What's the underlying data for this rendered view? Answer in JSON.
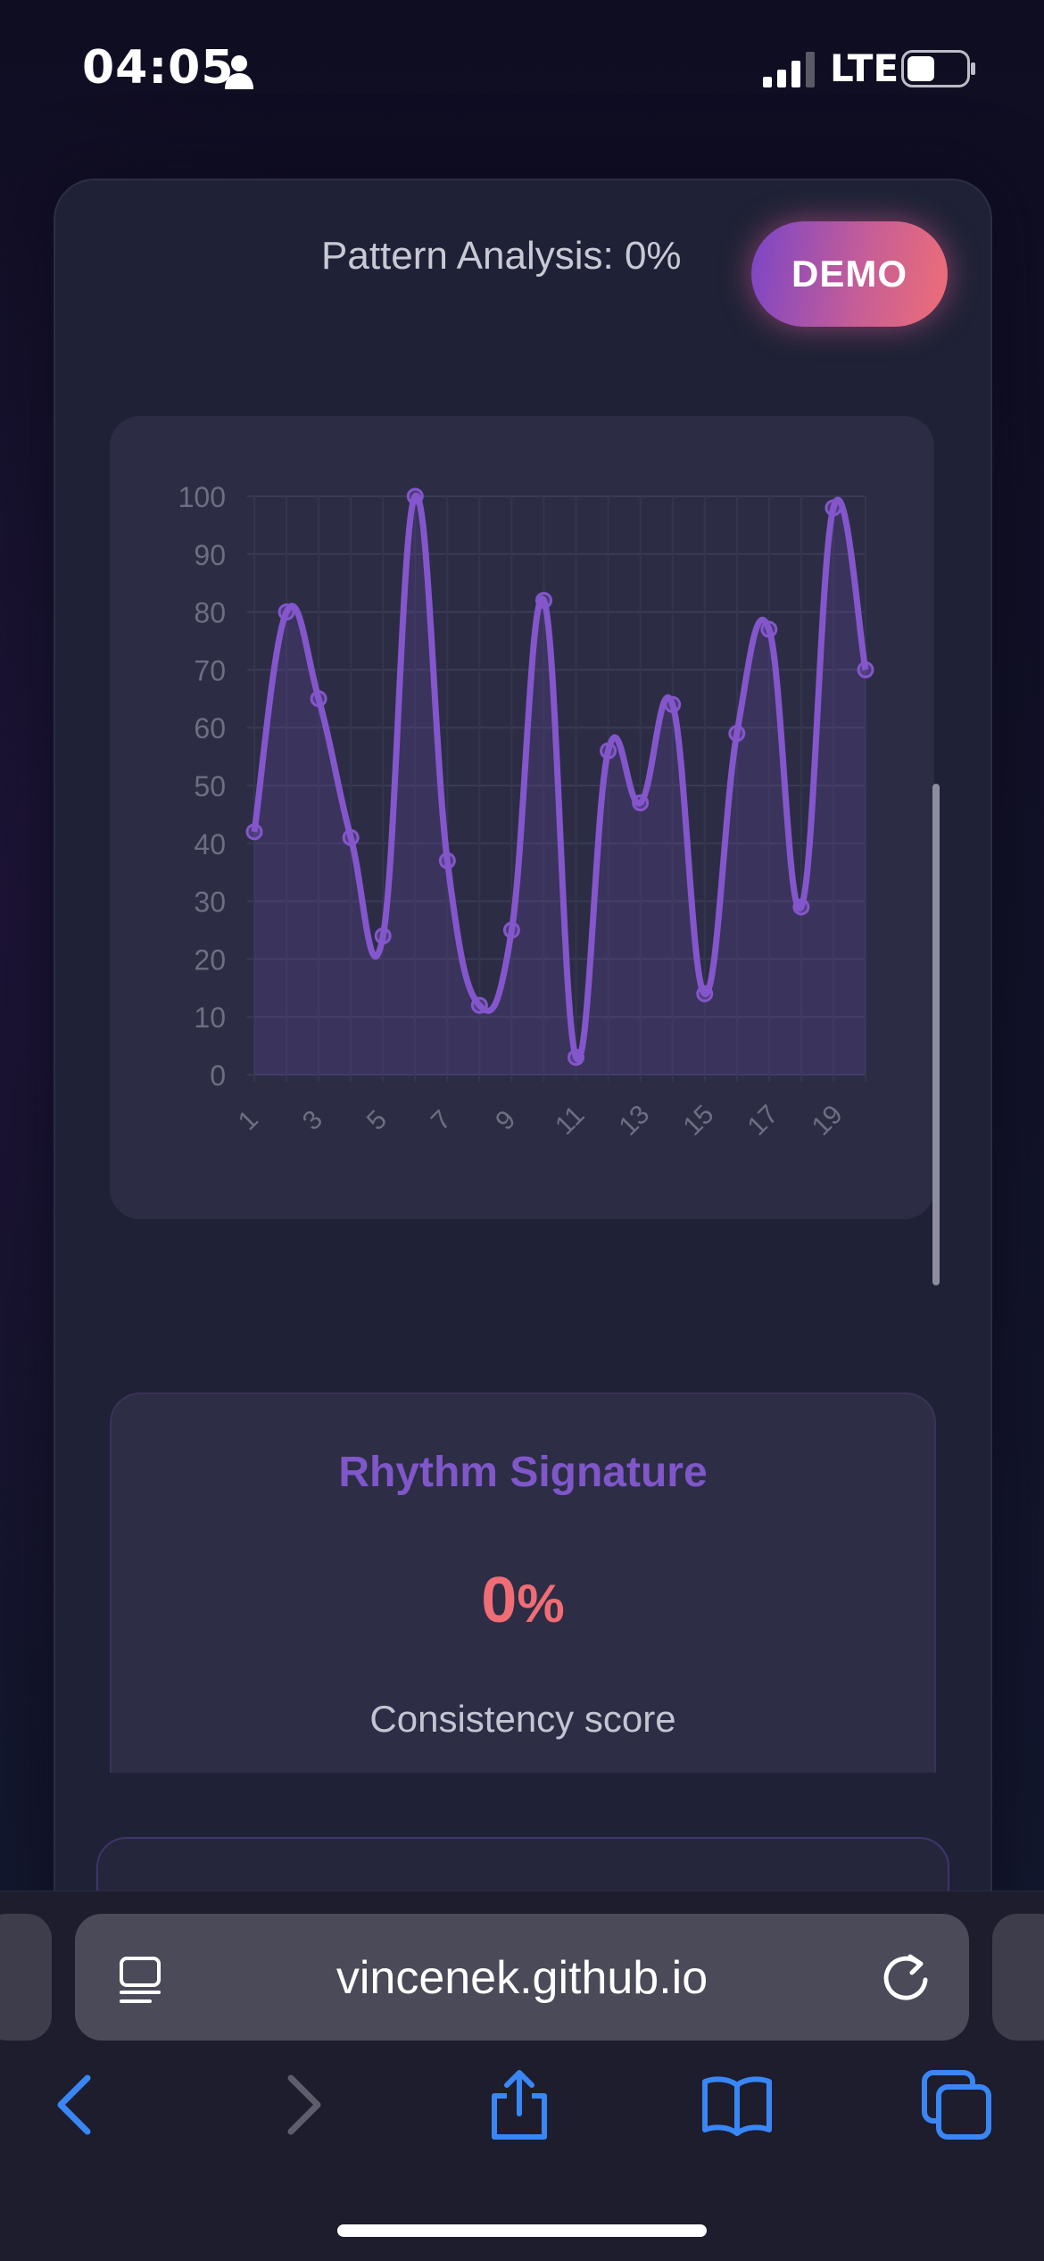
{
  "status_bar": {
    "time": "04:05",
    "network": "LTE",
    "icons": [
      "person-icon",
      "signal-icon",
      "battery-icon"
    ]
  },
  "header": {
    "pattern_analysis": "Pattern Analysis: 0%",
    "demo_label": "DEMO"
  },
  "chart_data": {
    "type": "line",
    "smooth": true,
    "filled": true,
    "x": [
      1,
      2,
      3,
      4,
      5,
      6,
      7,
      8,
      9,
      10,
      11,
      12,
      13,
      14,
      15,
      16,
      17,
      18,
      19,
      20
    ],
    "x_tick_labels": [
      "1",
      "3",
      "5",
      "7",
      "9",
      "11",
      "13",
      "15",
      "17",
      "19"
    ],
    "y_tick_labels": [
      "0",
      "10",
      "20",
      "30",
      "40",
      "50",
      "60",
      "70",
      "80",
      "90",
      "100"
    ],
    "series": [
      {
        "values": [
          42,
          80,
          65,
          41,
          24,
          100,
          37,
          12,
          25,
          82,
          3,
          56,
          47,
          64,
          14,
          59,
          77,
          29,
          98,
          70
        ],
        "color": "#8456cc"
      }
    ],
    "ylim": [
      0,
      100
    ],
    "grid": true,
    "title": "",
    "xlabel": "",
    "ylabel": ""
  },
  "rhythm_card": {
    "title": "Rhythm Signature",
    "value": "0",
    "unit": "%",
    "caption": "Consistency score"
  },
  "next_card": {
    "title_partial": ""
  },
  "browser": {
    "url": "vincenek.github.io",
    "icons": [
      "reader-icon",
      "reload-icon",
      "back-icon",
      "forward-icon",
      "share-icon",
      "bookmarks-icon",
      "tabs-icon"
    ]
  },
  "colors": {
    "accent": "#8456cc",
    "score": "#f06d75",
    "ios_blue": "#3a86f5"
  }
}
